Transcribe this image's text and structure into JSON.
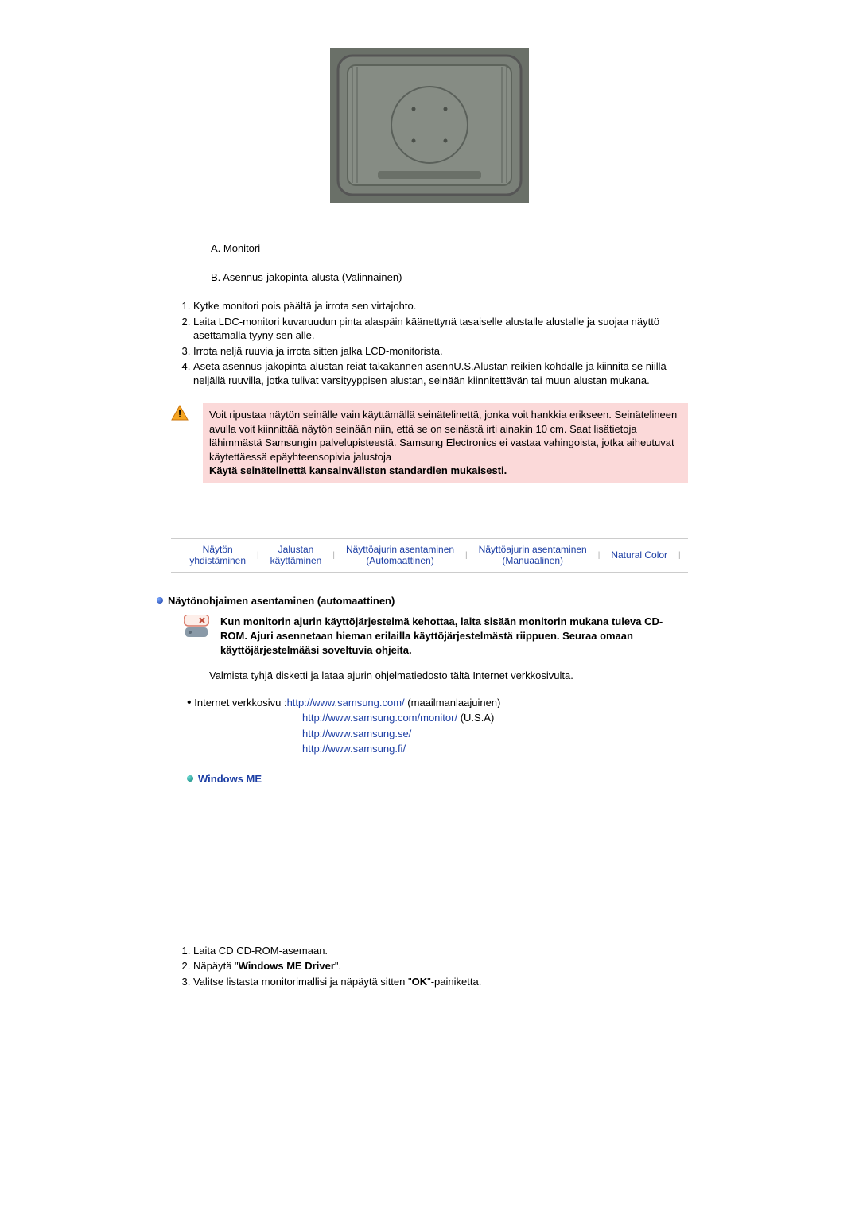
{
  "letters": {
    "a": "A. Monitori",
    "b": "B. Asennus-jakopinta-alusta (Valinnainen)"
  },
  "steps": [
    "Kytke monitori pois päältä ja irrota sen virtajohto.",
    "Laita LDC-monitori kuvaruudun pinta alaspäin käänettynä tasaiselle alustalle alustalle ja suojaa näyttö asettamalla tyyny sen alle.",
    "Irrota neljä ruuvia ja irrota sitten jalka LCD-monitorista.",
    "Aseta asennus-jakopinta-alustan reiät takakannen asennU.S.Alustan reikien kohdalle ja kiinnitä se niillä neljällä ruuvilla, jotka tulivat varsityyppisen alustan, seinään kiinnitettävän tai muun alustan mukana."
  ],
  "warning": {
    "body": "Voit ripustaa näytön seinälle vain käyttämällä seinätelinettä, jonka voit hankkia erikseen. Seinätelineen avulla voit kiinnittää näytön seinään niin, että se on seinästä irti ainakin 10 cm. Saat lisätietoja lähimmästä Samsungin palvelupisteestä. Samsung Electronics ei vastaa vahingoista, jotka aiheutuvat käytettäessä epäyhteensopivia jalustoja",
    "bold": "Käytä seinätelinettä kansainvälisten standardien mukaisesti."
  },
  "tabs": [
    {
      "l1": "Näytön",
      "l2": "yhdistäminen"
    },
    {
      "l1": "Jalustan",
      "l2": "käyttäminen"
    },
    {
      "l1": "Näyttöajurin asentaminen",
      "l2": "(Automaattinen)"
    },
    {
      "l1": "Näyttöajurin asentaminen",
      "l2": "(Manuaalinen)"
    },
    {
      "l1": "Natural Color",
      "l2": ""
    }
  ],
  "section_title": "Näytönohjaimen asentaminen (automaattinen)",
  "info_text": "Kun monitorin ajurin käyttöjärjestelmä kehottaa, laita sisään monitorin mukana tuleva CD-ROM. Ajuri asennetaan hieman erilailla käyttöjärjestelmästä riippuen. Seuraa omaan käyttöjärjestelmääsi soveltuvia ohjeita.",
  "prepare_text": "Valmista tyhjä disketti ja lataa ajurin ohjelmatiedosto tältä Internet verkkosivulta.",
  "links": {
    "label": "Internet verkkosivu :",
    "items": [
      {
        "url": "http://www.samsung.com/",
        "suffix": " (maailmanlaajuinen)"
      },
      {
        "url": "http://www.samsung.com/monitor/",
        "suffix": " (U.S.A)"
      },
      {
        "url": "http://www.samsung.se/",
        "suffix": ""
      },
      {
        "url": "http://www.samsung.fi/",
        "suffix": ""
      }
    ]
  },
  "windows_heading": "Windows ME",
  "win_steps": {
    "s1": "Laita CD CD-ROM-asemaan.",
    "s2_pre": "Näpäytä \"",
    "s2_bold": "Windows ME Driver",
    "s2_post": "\".",
    "s3_pre": "Valitse listasta monitorimallisi ja näpäytä sitten \"",
    "s3_bold": "OK",
    "s3_post": "\"-painiketta."
  }
}
